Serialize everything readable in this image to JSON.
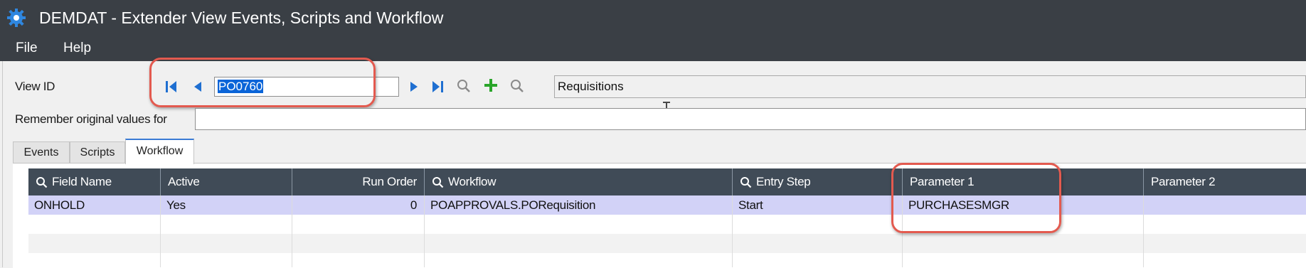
{
  "window": {
    "title": "DEMDAT - Extender View Events, Scripts and Workflow"
  },
  "menu": {
    "items": [
      "File",
      "Help"
    ]
  },
  "view_id": {
    "label": "View ID",
    "value": "PO0760",
    "description": "Requisitions"
  },
  "remember": {
    "label": "Remember original values for",
    "value": ""
  },
  "tabs": [
    {
      "label": "Events",
      "active": false
    },
    {
      "label": "Scripts",
      "active": false
    },
    {
      "label": "Workflow",
      "active": true
    }
  ],
  "grid": {
    "columns": [
      "Field Name",
      "Active",
      "Run Order",
      "Workflow",
      "Entry Step",
      "Parameter 1",
      "Parameter 2"
    ],
    "rows": [
      {
        "field_name": "ONHOLD",
        "active": "Yes",
        "run_order": "0",
        "workflow": "POAPPROVALS.PORequisition",
        "entry_step": "Start",
        "parameter1": "PURCHASESMGR",
        "parameter2": ""
      }
    ]
  },
  "colors": {
    "accent": "#e35a4f",
    "header": "#404b57",
    "selected_row": "#d2d2f7",
    "titlebar": "#3a3f45",
    "nav_blue": "#1f6fd1",
    "add_green": "#2aa52a"
  }
}
